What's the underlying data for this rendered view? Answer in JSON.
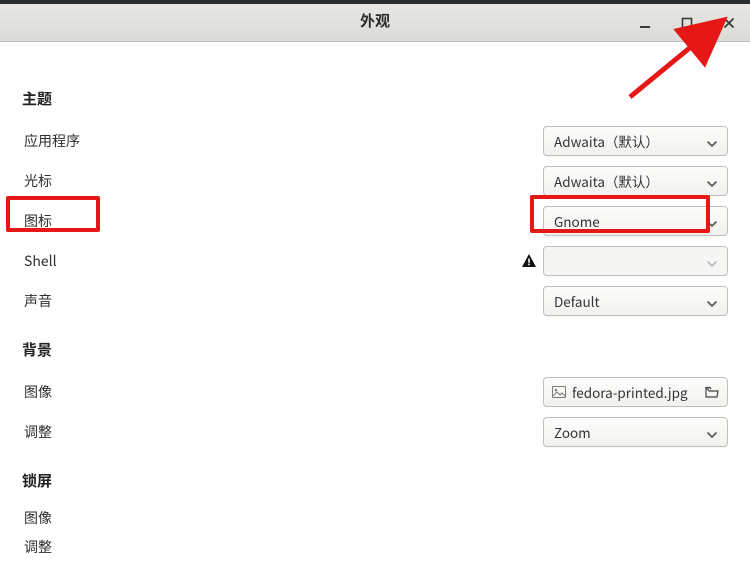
{
  "title": "外观",
  "sections": {
    "themes": {
      "header": "主题",
      "app_label": "应用程序",
      "app_value": "Adwaita（默认）",
      "cursor_label": "光标",
      "cursor_value": "Adwaita（默认）",
      "icons_label": "图标",
      "icons_value": "Gnome",
      "shell_label": "Shell",
      "shell_value": "",
      "sound_label": "声音",
      "sound_value": "Default"
    },
    "background": {
      "header": "背景",
      "image_label": "图像",
      "image_value": "fedora-printed.jpg",
      "adjust_label": "调整",
      "adjust_value": "Zoom"
    },
    "lockscreen": {
      "header": "锁屏",
      "image_label": "图像",
      "adjust_label": "调整"
    }
  }
}
